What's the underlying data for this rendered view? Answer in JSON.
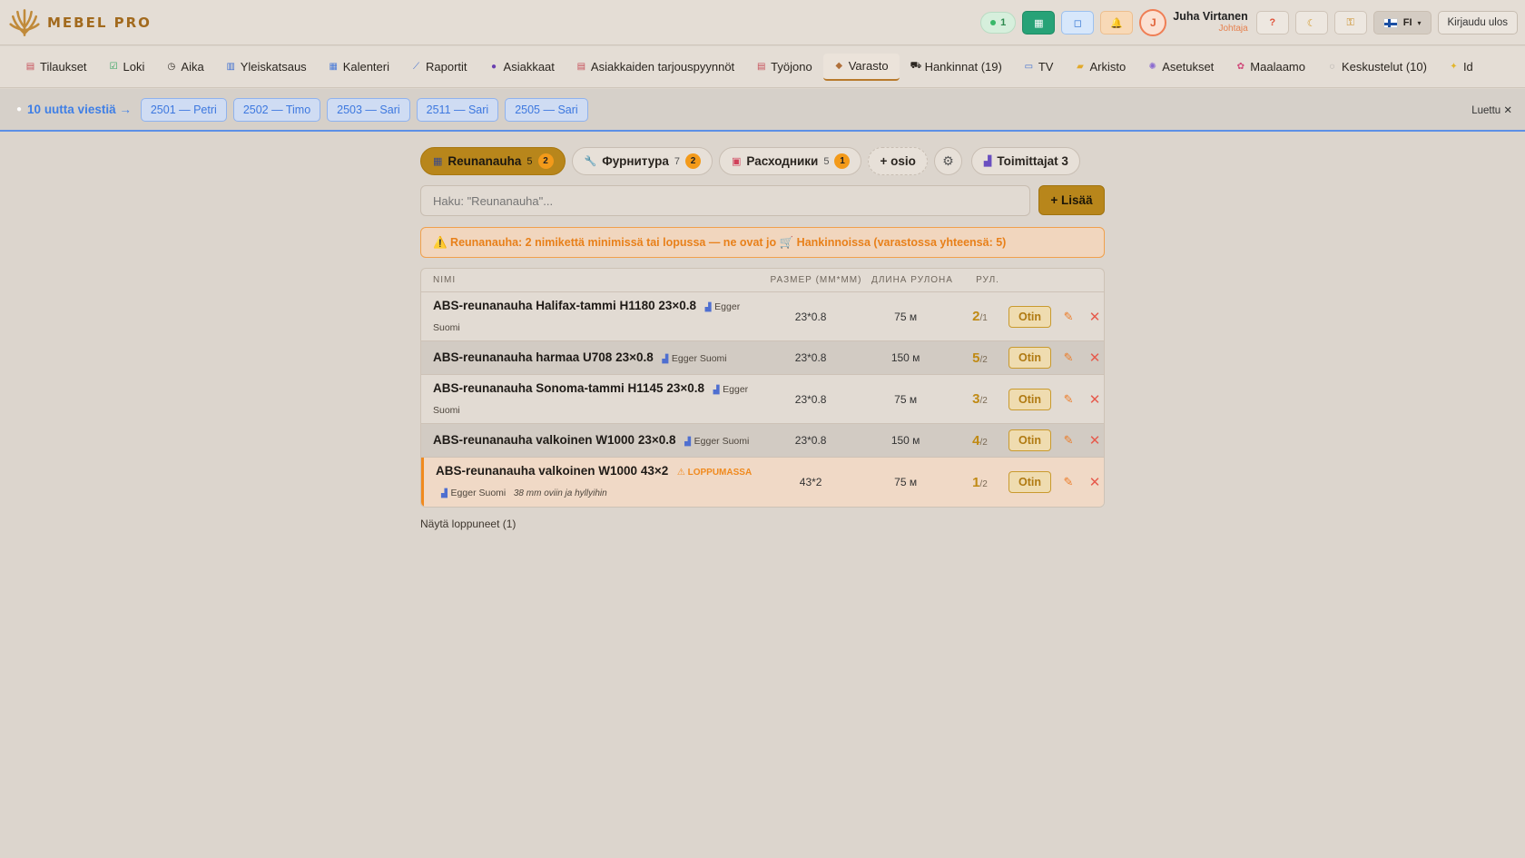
{
  "header": {
    "brand": "MEBEL PRO",
    "status_count": "1",
    "user_name": "Juha Virtanen",
    "user_role": "Johtaja",
    "avatar_letter": "J",
    "help_label": "?",
    "lang_label": "FI",
    "logout_label": "Kirjaudu ulos"
  },
  "nav": {
    "items": [
      {
        "label": "Tilaukset"
      },
      {
        "label": "Loki"
      },
      {
        "label": "Aika"
      },
      {
        "label": "Yleiskatsaus"
      },
      {
        "label": "Kalenteri"
      },
      {
        "label": "Raportit"
      },
      {
        "label": "Asiakkaat"
      },
      {
        "label": "Asiakkaiden tarjouspyynnöt"
      },
      {
        "label": "Työjono"
      },
      {
        "label": "Varasto"
      },
      {
        "label": "Hankinnat (19)"
      },
      {
        "label": "TV"
      },
      {
        "label": "Arkisto"
      },
      {
        "label": "Asetukset"
      },
      {
        "label": "Maalaamo"
      },
      {
        "label": "Keskustelut (10)"
      },
      {
        "label": "Id"
      }
    ]
  },
  "messages": {
    "link": "10 uutta viestiä →",
    "chips": [
      "2501 — Petri",
      "2502 — Timo",
      "2503 — Sari",
      "2511 — Sari",
      "2505 — Sari"
    ],
    "read_label": "Luettu ✕"
  },
  "tabs": [
    {
      "label": "Reunanauha",
      "count": "5",
      "badge": "2"
    },
    {
      "label": "Фурнитура",
      "count": "7",
      "badge": "2"
    },
    {
      "label": "Расходники",
      "count": "5",
      "badge": "1"
    },
    {
      "label": "+ osio"
    },
    {
      "label": "Toimittajat 3"
    }
  ],
  "search": {
    "placeholder": "Haku: \"Reunanauha\"..."
  },
  "add_label": "+ Lisää",
  "alert": "⚠️ Reunanauha: 2 nimikettä minimissä tai lopussa — ne ovat jo 🛒 Hankinnoissa (varastossa yhteensä: 5)",
  "table": {
    "headers": {
      "name": "Nimi",
      "size": "Размер (мм*мм)",
      "length": "Длина рулона",
      "rolls": "Рул."
    },
    "rows": [
      {
        "title": "ABS-reunanauha Halifax-tammi H1180 23×0.8",
        "supplier": "Egger Suomi",
        "size": "23*0.8",
        "length": "75 м",
        "rolls": "2",
        "min": "/1",
        "action": "Otin"
      },
      {
        "title": "ABS-reunanauha harmaa U708 23×0.8",
        "supplier": "Egger Suomi",
        "size": "23*0.8",
        "length": "150 м",
        "rolls": "5",
        "min": "/2",
        "action": "Otin"
      },
      {
        "title": "ABS-reunanauha Sonoma-tammi H1145 23×0.8",
        "supplier": "Egger Suomi",
        "size": "23*0.8",
        "length": "75 м",
        "rolls": "3",
        "min": "/2",
        "action": "Otin"
      },
      {
        "title": "ABS-reunanauha valkoinen W1000 23×0.8",
        "supplier": "Egger Suomi",
        "size": "23*0.8",
        "length": "150 м",
        "rolls": "4",
        "min": "/2",
        "action": "Otin"
      },
      {
        "title": "ABS-reunanauha valkoinen W1000 43×2",
        "tag": "⚠ LOPPUMASSA",
        "supplier": "Egger Suomi",
        "note": "38 mm oviin ja hyllyihin",
        "size": "43*2",
        "length": "75 м",
        "rolls": "1",
        "min": "/2",
        "action": "Otin"
      }
    ]
  },
  "show_ended": "Näytä loppuneet (1)"
}
